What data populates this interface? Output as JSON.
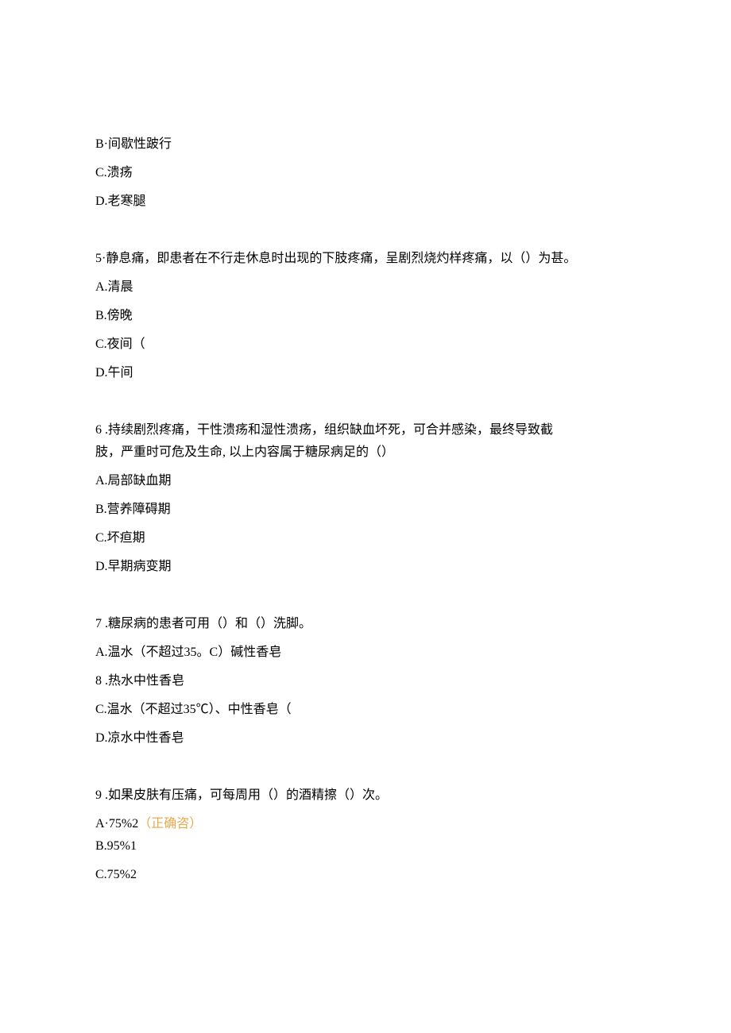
{
  "q4": {
    "optB": "B·间歇性跛行",
    "optC": "C.溃疡",
    "optD": "D.老寒腿"
  },
  "q5": {
    "text": "5·静息痛，即患者在不行走休息时出现的下肢疼痛，呈剧烈烧灼样疼痛，以（）为甚。",
    "optA": "A.清晨",
    "optB": "B.傍晚",
    "optC": "C.夜间（",
    "optD": "D.午间"
  },
  "q6": {
    "text1": "6  .持续剧烈疼痛，干性溃疡和湿性溃疡，组织缺血坏死，可合并感染，最终导致截",
    "text2": "肢，严重时可危及生命, 以上内容属于糖尿病足的（）",
    "optA": "A.局部缺血期",
    "optB": "B.营养障碍期",
    "optC": "C.坏疸期",
    "optD": "D.早期病变期"
  },
  "q7": {
    "text": "7  .糖尿病的患者可用（）和（）洗脚。",
    "optA": "A.温水（不超过35。C）碱性香皂",
    "optB": "8  .热水中性香皂",
    "optC": "C.温水（不超过35℃）、中性香皂（",
    "optD": "D.凉水中性香皂"
  },
  "q9": {
    "text": "9  .如果皮肤有压痛，可每周用（）的酒精擦（）次。",
    "optA_prefix": "A·75%2",
    "optA_annotation": "（正确咨）",
    "optB": "B.95%1",
    "optC": "C.75%2"
  }
}
